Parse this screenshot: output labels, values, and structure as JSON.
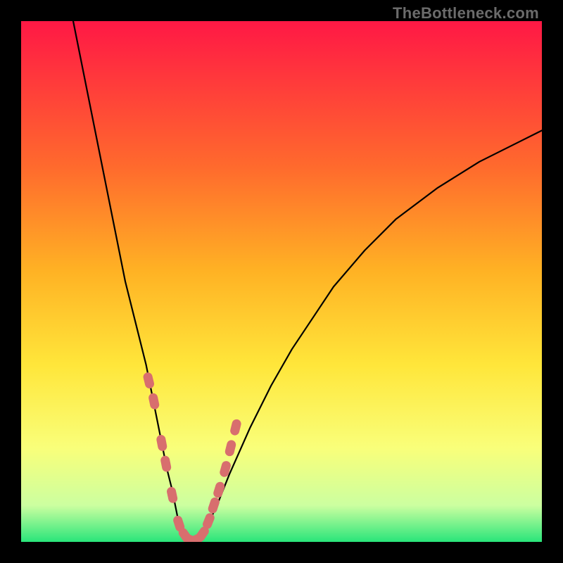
{
  "watermark_text": "TheBottleneck.com",
  "colors": {
    "gradient_top": "#ff1845",
    "gradient_mid1": "#ff6a2d",
    "gradient_mid2": "#ffb224",
    "gradient_mid3": "#ffe63a",
    "gradient_mid4": "#f9ff7a",
    "gradient_mid5": "#ccffa0",
    "gradient_bottom": "#29e57a",
    "curve": "#000000",
    "marker_fill": "#d86e6e",
    "marker_stroke": "#d86e6e"
  },
  "chart_data": {
    "type": "line",
    "title": "",
    "xlabel": "",
    "ylabel": "",
    "xlim": [
      0,
      100
    ],
    "ylim": [
      0,
      100
    ],
    "grid": false,
    "legend": false,
    "note": "V-shaped bottleneck curve. x is a notional component-capacity axis, y is bottleneck %. Minimum ≈ 0 around x≈30-34.",
    "series": [
      {
        "name": "bottleneck-curve",
        "x": [
          10,
          12,
          14,
          16,
          18,
          20,
          22,
          24,
          26,
          27,
          28,
          29,
          30,
          31,
          32,
          33,
          34,
          35,
          36,
          38,
          40,
          44,
          48,
          52,
          56,
          60,
          66,
          72,
          80,
          88,
          96,
          100
        ],
        "values": [
          100,
          90,
          80,
          70,
          60,
          50,
          42,
          34,
          24,
          19,
          14,
          10,
          5,
          2,
          0.5,
          0.2,
          0.5,
          1.5,
          3.5,
          8,
          13,
          22,
          30,
          37,
          43,
          49,
          56,
          62,
          68,
          73,
          77,
          79
        ]
      }
    ],
    "highlight_points": {
      "name": "near-zero-region",
      "x": [
        24.5,
        25.5,
        27,
        27.8,
        29,
        30.3,
        31.5,
        32.5,
        33.5,
        34.8,
        36,
        37,
        38,
        39.2,
        40.2,
        41.2
      ],
      "values": [
        31,
        27,
        19,
        15,
        9,
        3.5,
        1.2,
        0.4,
        0.4,
        1.5,
        4,
        7,
        10,
        14,
        18,
        22
      ]
    }
  }
}
